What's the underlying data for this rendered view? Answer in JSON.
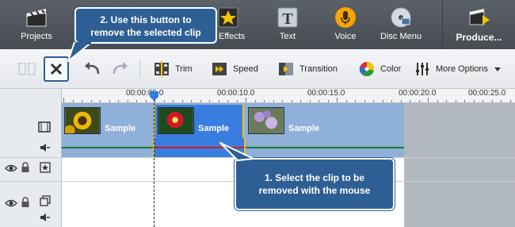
{
  "main_toolbar": {
    "projects": "Projects",
    "video_effects": "o Effects",
    "text": "Text",
    "voice": "Voice",
    "disc_menu": "Disc Menu",
    "produce": "Produce..."
  },
  "sub_toolbar": {
    "trim": "Trim",
    "speed": "Speed",
    "transition": "Transition",
    "color": "Color",
    "more_options": "More Options"
  },
  "ruler": {
    "labels": [
      "00:00:05.0",
      "00:00:10.0",
      "00:00:15.0",
      "00:00:20.0",
      "00:00:25.0"
    ]
  },
  "clips": [
    {
      "label": "Sample"
    },
    {
      "label": "Sample"
    },
    {
      "label": "Sample"
    }
  ],
  "callouts": {
    "remove_button": {
      "line1": "2. Use this button to",
      "line2": "remove the selected clip"
    },
    "select_clip": {
      "line1": "1. Select the clip to be",
      "line2": "removed with the mouse"
    }
  },
  "colors": {
    "callout_bg": "#2e5f94",
    "selected_clip": "#3a7de0",
    "selection_border": "#f2c200",
    "audio_line": "#cc2020"
  }
}
